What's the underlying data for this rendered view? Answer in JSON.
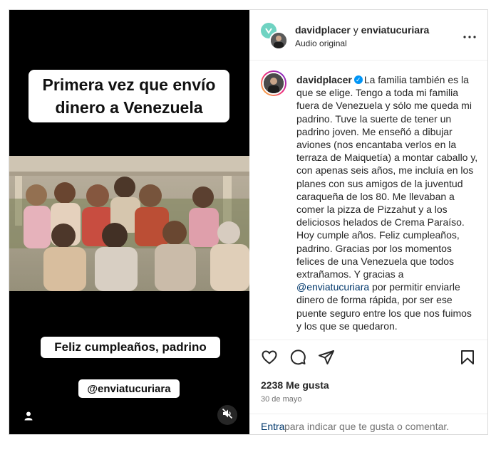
{
  "media": {
    "top_caption": "Primera vez que envío\ndinero a Venezuela",
    "mid_caption": "Feliz cumpleaños, padrino",
    "tag_caption": "@enviatucuriara"
  },
  "header": {
    "user1": "davidplacer",
    "conjunction": "y",
    "user2": "enviatucuriara",
    "audio": "Audio original"
  },
  "comment": {
    "username": "davidplacer",
    "text_before_mention": "La familia también es la que se elige. Tengo a toda mi familia fuera de Venezuela y sólo me queda mi padrino. Tuve la suerte de tener un padrino joven. Me enseñó a dibujar aviones (nos encantaba verlos en la terraza de Maiquetía) a montar caballo y, con apenas seis años, me incluía en los planes con sus amigos de la juventud caraqueña de los 80. Me llevaban a comer la pizza de Pizzahut y a los deliciosos helados de Crema Paraíso.\nHoy cumple años. Feliz cumpleaños, padrino. Gracias por los momentos felices de una Venezuela que todos extrañamos. Y gracias a ",
    "mention": "@enviatucuriara",
    "text_after_mention": " por permitir enviarle dinero de forma rápida, por ser ese puente seguro entre los que nos fuimos y los que se quedaron."
  },
  "engagement": {
    "likes": "2238 Me gusta",
    "date": "30 de mayo"
  },
  "add_comment": {
    "post_label": "Entra",
    "placeholder": "para indicar que te gusta o comentar."
  },
  "icons": [
    "heart-icon",
    "comment-icon",
    "share-icon",
    "bookmark-icon",
    "more-icon",
    "user-icon",
    "mute-icon",
    "verified-icon"
  ],
  "colors": {
    "media_background": "#000000",
    "verified": "#0095f6",
    "link": "#00376b",
    "secondary_text": "#737373",
    "border": "#dbdbdb"
  }
}
